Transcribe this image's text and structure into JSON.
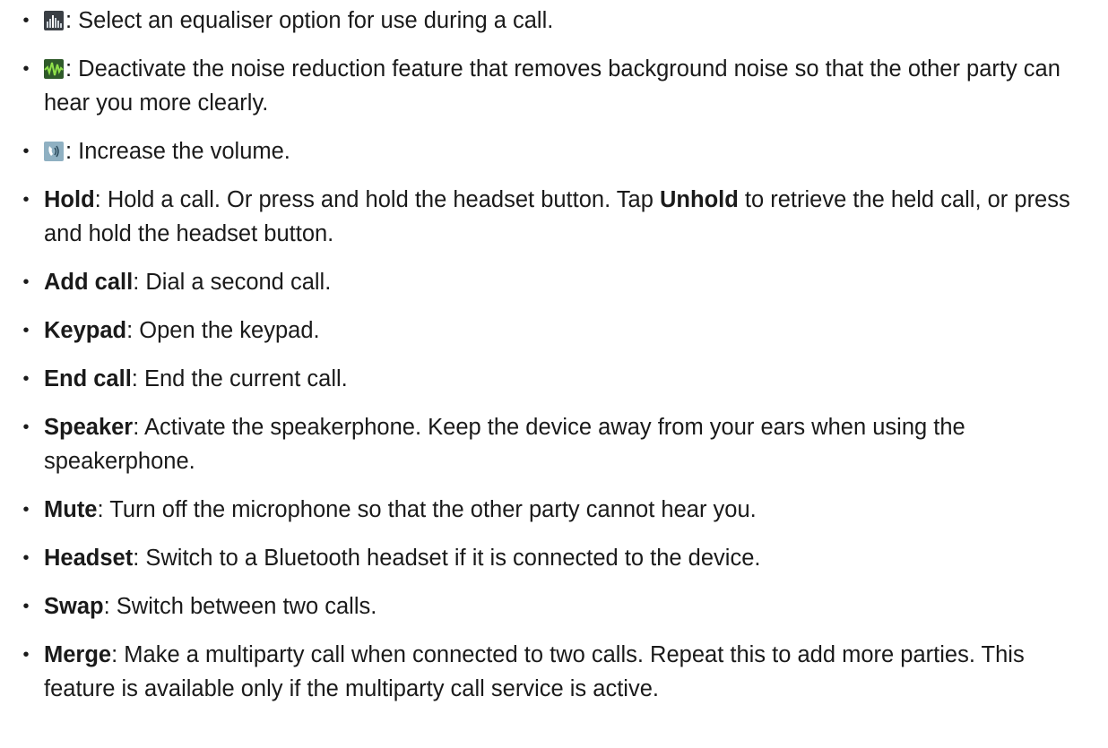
{
  "items": [
    {
      "icon": "equaliser-icon",
      "desc": ": Select an equaliser option for use during a call."
    },
    {
      "icon": "noise-reduction-icon",
      "desc": ": Deactivate the noise reduction feature that removes background noise so that the other party can hear you more clearly."
    },
    {
      "icon": "volume-boost-icon",
      "desc": ": Increase the volume."
    },
    {
      "term": "Hold",
      "desc_before": ": Hold a call. Or press and hold the headset button. Tap ",
      "term2": "Unhold",
      "desc_after": " to retrieve the held call, or press and hold the headset button."
    },
    {
      "term": "Add call",
      "desc": ": Dial a second call."
    },
    {
      "term": "Keypad",
      "desc": ": Open the keypad."
    },
    {
      "term": "End call",
      "desc": ": End the current call."
    },
    {
      "term": "Speaker",
      "desc": ": Activate the speakerphone. Keep the device away from your ears when using the speakerphone."
    },
    {
      "term": "Mute",
      "desc": ": Turn off the microphone so that the other party cannot hear you."
    },
    {
      "term": "Headset",
      "desc": ": Switch to a Bluetooth headset if it is connected to the device."
    },
    {
      "term": "Swap",
      "desc": ": Switch between two calls."
    },
    {
      "term": "Merge",
      "desc": ": Make a multiparty call when connected to two calls. Repeat this to add more parties. This feature is available only if the multiparty call service is active."
    }
  ],
  "bullet_char": "•",
  "colors": {
    "text": "#1a1a1a",
    "equaliser_bg": "#3a3f45",
    "noise_bg": "#2f5a2a",
    "noise_wave": "#8fe04a",
    "volume_bg": "#8fb0c2"
  }
}
